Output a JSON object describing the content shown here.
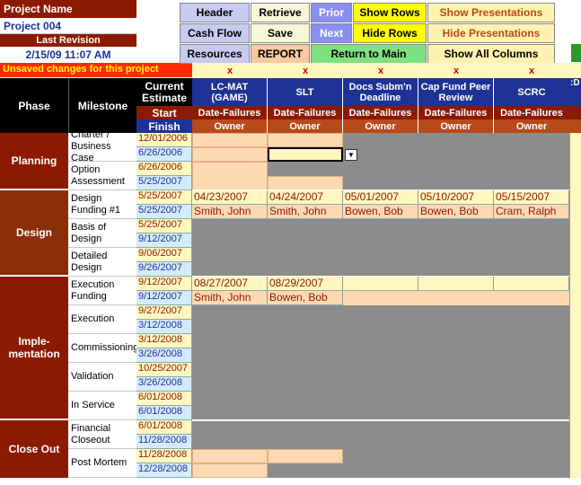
{
  "project": {
    "name_label": "Project Name",
    "name": "Project 004",
    "revision_label": "Last Revision",
    "revision": "2/15/09 11:07 AM",
    "unsaved": "Unsaved changes for this project"
  },
  "toolbar": {
    "header": "Header",
    "retrieve": "Retrieve",
    "prior": "Prior",
    "show_rows": "Show Rows",
    "show_presentations": "Show Presentations",
    "cash_flow": "Cash Flow",
    "save": "Save",
    "next": "Next",
    "hide_rows": "Hide Rows",
    "hide_presentations": "Hide Presentations",
    "resources": "Resources",
    "report": "REPORT",
    "return_main": "Return to Main",
    "show_all_columns": "Show All Columns"
  },
  "grid": {
    "phase_header": "Phase",
    "milestone_header": "Milestone",
    "estimate_header": "Current Estimate",
    "start_label": "Start",
    "finish_label": "Finish",
    "x_mark": "x",
    "columns": [
      {
        "title": "LC-MAT (GAME)",
        "sub": "Date-Failures",
        "owner": "Owner"
      },
      {
        "title": "SLT",
        "sub": "Date-Failures",
        "owner": "Owner"
      },
      {
        "title": "Docs Subm'n Deadline",
        "sub": "Date-Failures",
        "owner": "Owner"
      },
      {
        "title": "Cap Fund Peer Review",
        "sub": "Date-Failures",
        "owner": "Owner"
      },
      {
        "title": "SCRC",
        "sub": "Date-Failures",
        "owner": "Owner"
      }
    ],
    "overflow_col": ":D",
    "phases": {
      "planning": "Planning",
      "design": "Design",
      "implementation": "Imple-\nmentation",
      "closeout": "Close Out"
    },
    "milestones": [
      {
        "name": "Charter / Business Case",
        "start": "12/01/2006",
        "finish": "6/26/2006"
      },
      {
        "name": "Option Assessment",
        "start": "6/26/2006",
        "finish": "5/25/2007"
      },
      {
        "name": "Design Funding #1",
        "start": "5/25/2007",
        "finish": "5/25/2007"
      },
      {
        "name": "Basis of Design",
        "start": "5/25/2007",
        "finish": "9/12/2007"
      },
      {
        "name": "Detailed Design",
        "start": "9/06/2007",
        "finish": "9/26/2007"
      },
      {
        "name": "Execution Funding",
        "start": "9/12/2007",
        "finish": "9/12/2007"
      },
      {
        "name": "Execution",
        "start": "9/27/2007",
        "finish": "3/12/2008"
      },
      {
        "name": "Commissioning",
        "start": "3/12/2008",
        "finish": "3/26/2008"
      },
      {
        "name": "Validation",
        "start": "10/25/2007",
        "finish": "3/26/2008"
      },
      {
        "name": "In Service",
        "start": "6/01/2008",
        "finish": "6/01/2008"
      },
      {
        "name": "Financial Closeout",
        "start": "6/01/2008",
        "finish": "11/28/2008"
      },
      {
        "name": "Post Mortem",
        "start": "11/28/2008",
        "finish": "12/28/2008"
      }
    ],
    "design_funding": {
      "dates": [
        "04/23/2007",
        "04/24/2007",
        "05/01/2007",
        "05/10/2007",
        "05/15/2007"
      ],
      "owners": [
        "Smith, John",
        "Smith, John",
        "Bowen, Bob",
        "Bowen, Bob",
        "Cram, Ralph"
      ]
    },
    "execution_funding": {
      "dates": [
        "08/27/2007",
        "08/29/2007"
      ],
      "owners": [
        "Smith, John",
        "Bowen, Bob"
      ]
    }
  },
  "colors": {
    "planning": "#8c1a00",
    "design": "#8c2e0a",
    "implementation": "#8c1a00",
    "closeout": "#8c1a00",
    "header_blue": "#1e3296"
  }
}
